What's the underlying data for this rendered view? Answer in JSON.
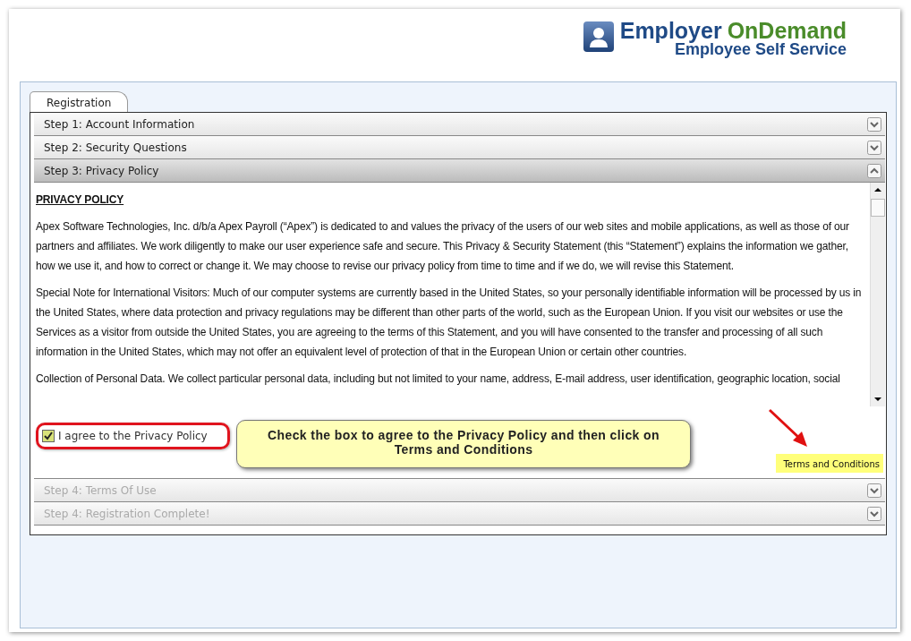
{
  "logo": {
    "word_1": "Employer",
    "word_2": "OnDemand",
    "subtitle": "Employee Self Service"
  },
  "tabs": [
    {
      "label": "Registration",
      "selected": true
    }
  ],
  "steps": [
    {
      "label": "Step 1: Account Information",
      "expanded": false,
      "disabled": false
    },
    {
      "label": "Step 2: Security Questions",
      "expanded": false,
      "disabled": false
    },
    {
      "label": "Step 3: Privacy Policy",
      "expanded": true,
      "disabled": false
    },
    {
      "label": "Step 4: Terms Of Use",
      "expanded": false,
      "disabled": true
    },
    {
      "label": "Step 4: Registration Complete!",
      "expanded": false,
      "disabled": true
    }
  ],
  "policy": {
    "heading": "PRIVACY POLICY",
    "paragraphs": [
      "Apex Software Technologies, Inc. d/b/a Apex Payroll (“Apex”) is dedicated to and values the privacy of the users of our web sites and mobile applications, as well as those of our partners and affiliates. We work diligently to make our user experience safe and secure. This Privacy & Security Statement (this “Statement”) explains the information we gather, how we use it, and how to correct or change it. We may choose to revise our privacy policy from time to time and if we do, we will revise this Statement.",
      "Special Note for International Visitors: Much of our computer systems are currently based in the United States, so your personally identifiable information will be processed by us in the United States, where data protection and privacy regulations may be different than other parts of the world, such as the European Union. If you visit our websites or use the Services as a visitor from outside the United States, you are agreeing to the terms of this Statement, and you will have consented to the transfer and processing of all such information in the United States, which may not offer an equivalent level of protection of that in the European Union or certain other countries.",
      "Collection of Personal Data. We collect particular personal data, including but not limited to your name, address, E-mail address, user identification, geographic location, social"
    ]
  },
  "agree": {
    "label": "I agree to the Privacy Policy",
    "checked": true
  },
  "callout": "Check the box to agree to the Privacy Policy and then click on Terms and Conditions",
  "terms_link": "Terms and Conditions"
}
